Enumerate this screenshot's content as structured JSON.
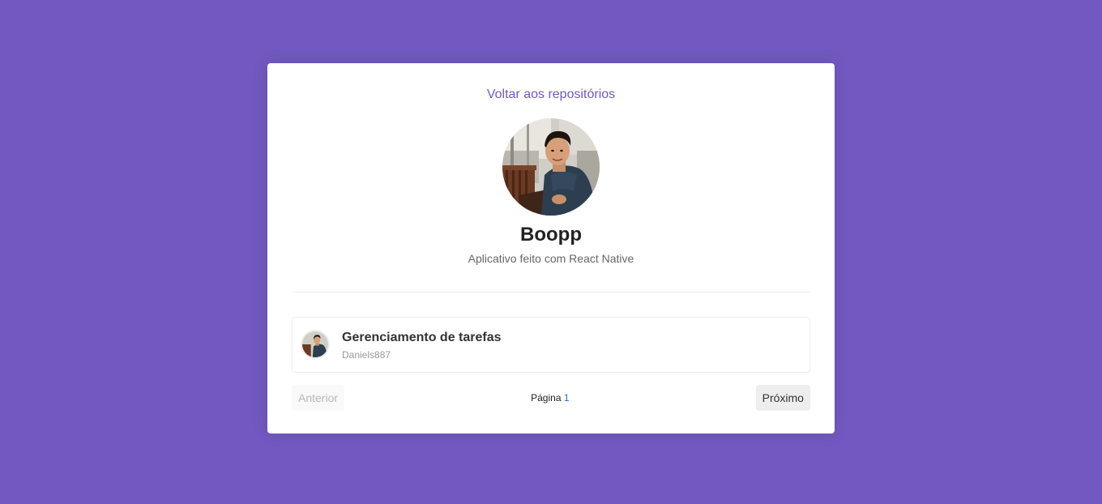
{
  "owner": {
    "back_link": "Voltar aos repositórios",
    "name": "Boopp",
    "description": "Aplicativo feito com React Native"
  },
  "issues": [
    {
      "title": "Gerenciamento de tarefas",
      "author": "Daniels887"
    }
  ],
  "pagination": {
    "prev_label": "Anterior",
    "next_label": "Próximo",
    "page_prefix": "Página",
    "page_number": "1",
    "prev_disabled": true
  },
  "colors": {
    "background": "#7159c1",
    "accent": "#7159c1",
    "card": "#ffffff"
  }
}
